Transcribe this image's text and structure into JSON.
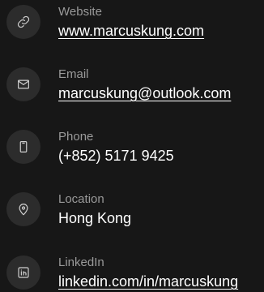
{
  "contacts": [
    {
      "label": "Website",
      "value": "www.marcuskung.com",
      "icon": "link-icon"
    },
    {
      "label": "Email",
      "value": "marcuskung@outlook.com",
      "icon": "mail-icon"
    },
    {
      "label": "Phone",
      "value": "(+852) 5171 9425",
      "icon": "phone-icon"
    },
    {
      "label": "Location",
      "value": "Hong Kong",
      "icon": "location-pin-icon"
    },
    {
      "label": "LinkedIn",
      "value": "linkedin.com/in/marcuskung",
      "icon": "linkedin-icon"
    }
  ],
  "colors": {
    "background": "#171717",
    "icon_circle": "#2c2c2c",
    "label": "#9a9a9a",
    "value": "#ffffff"
  }
}
